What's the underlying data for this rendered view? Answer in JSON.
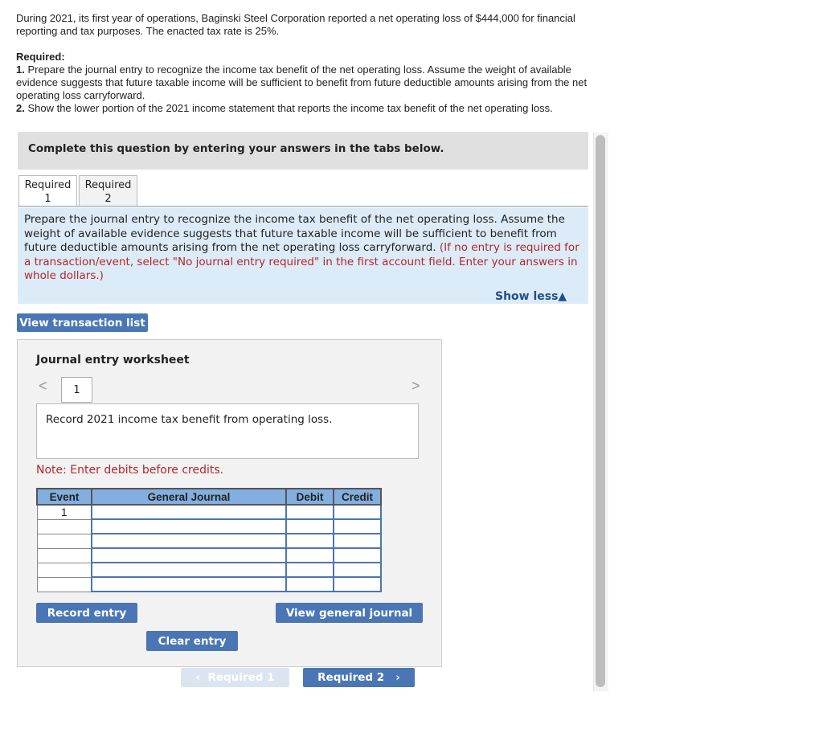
{
  "problem": {
    "intro": "During 2021, its first year of operations, Baginski Steel Corporation reported a net operating loss of $444,000 for financial reporting and tax purposes. The enacted tax rate is 25%.",
    "required_label": "Required:",
    "req1_num": "1.",
    "req1": " Prepare the journal entry to recognize the income tax benefit of the net operating loss. Assume the weight of available evidence suggests that future taxable income will be sufficient to benefit from future deductible amounts arising from the net operating loss carryforward.",
    "req2_num": "2.",
    "req2": " Show the lower portion of the 2021 income statement that reports the income tax benefit of the net operating loss."
  },
  "banner": "Complete this question by entering your answers in the tabs below.",
  "tabs": [
    {
      "l1": "Required",
      "l2": "1"
    },
    {
      "l1": "Required",
      "l2": "2"
    }
  ],
  "instructions": {
    "text": "Prepare the journal entry to recognize the income tax benefit of the net operating loss. Assume the weight of available evidence suggests that future taxable income will be sufficient to benefit from future deductible amounts arising from the net operating loss carryforward. ",
    "note": "(If no entry is required for a transaction/event, select \"No journal entry required\" in the first account field. Enter your answers in whole dollars.)",
    "show_less": "Show less▲"
  },
  "view_transaction_list": "View transaction list",
  "worksheet": {
    "title": "Journal entry worksheet",
    "prev": "<",
    "next": ">",
    "entry_number": "1",
    "description": "Record 2021 income tax benefit from operating loss.",
    "note": "Note: Enter debits before credits.",
    "columns": [
      "Event",
      "General Journal",
      "Debit",
      "Credit"
    ],
    "rows": [
      {
        "event": "1"
      },
      {
        "event": ""
      },
      {
        "event": ""
      },
      {
        "event": ""
      },
      {
        "event": ""
      },
      {
        "event": ""
      }
    ],
    "record_entry": "Record entry",
    "clear_entry": "Clear entry",
    "view_general_journal": "View general journal"
  },
  "nav": {
    "prev": "Required 1",
    "next": "Required 2",
    "prev_icon": "chevron-left",
    "next_icon": "chevron-right"
  },
  "colors": {
    "button": "#4a76b5",
    "header": "#82aee0",
    "instructions_bg": "#dcebf8",
    "note_red": "#b3262b"
  }
}
